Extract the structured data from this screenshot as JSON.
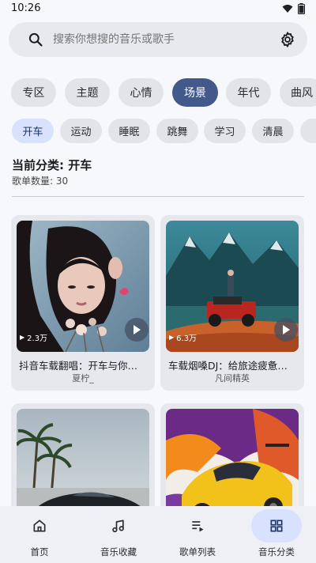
{
  "status": {
    "time": "10:26"
  },
  "search": {
    "placeholder": "搜索你想搜的音乐或歌手"
  },
  "categories": [
    {
      "label": "专区"
    },
    {
      "label": "主题"
    },
    {
      "label": "心情"
    },
    {
      "label": "场景"
    },
    {
      "label": "年代"
    },
    {
      "label": "曲风"
    }
  ],
  "subcategories": [
    {
      "label": "开车"
    },
    {
      "label": "运动"
    },
    {
      "label": "睡眠"
    },
    {
      "label": "跳舞"
    },
    {
      "label": "学习"
    },
    {
      "label": "清晨"
    }
  ],
  "current": {
    "label": "当前分类: 开车",
    "count": "歌单数量: 30"
  },
  "playlists": [
    {
      "title": "抖音车载翻唱：开车与你同行",
      "author": "夏柠_",
      "plays": "2.3万",
      "cover": "portrait-woman-flowers"
    },
    {
      "title": "车载烟嗓DJ：给旅途疲惫加点料",
      "author": "凡间精英",
      "plays": "6.3万",
      "cover": "red-jeep-mountains"
    },
    {
      "title": "",
      "author": "",
      "plays": "",
      "cover": "black-sports-car-palms"
    },
    {
      "title": "",
      "author": "",
      "plays": "",
      "cover": "yellow-sports-car-paint"
    }
  ],
  "nav": [
    {
      "label": "首页",
      "icon": "home-icon"
    },
    {
      "label": "音乐收藏",
      "icon": "music-note-icon"
    },
    {
      "label": "歌单列表",
      "icon": "playlist-icon"
    },
    {
      "label": "音乐分类",
      "icon": "grid-icon"
    }
  ],
  "colors": {
    "accent": "#44598b",
    "chip_active": "#d8e2ff"
  }
}
